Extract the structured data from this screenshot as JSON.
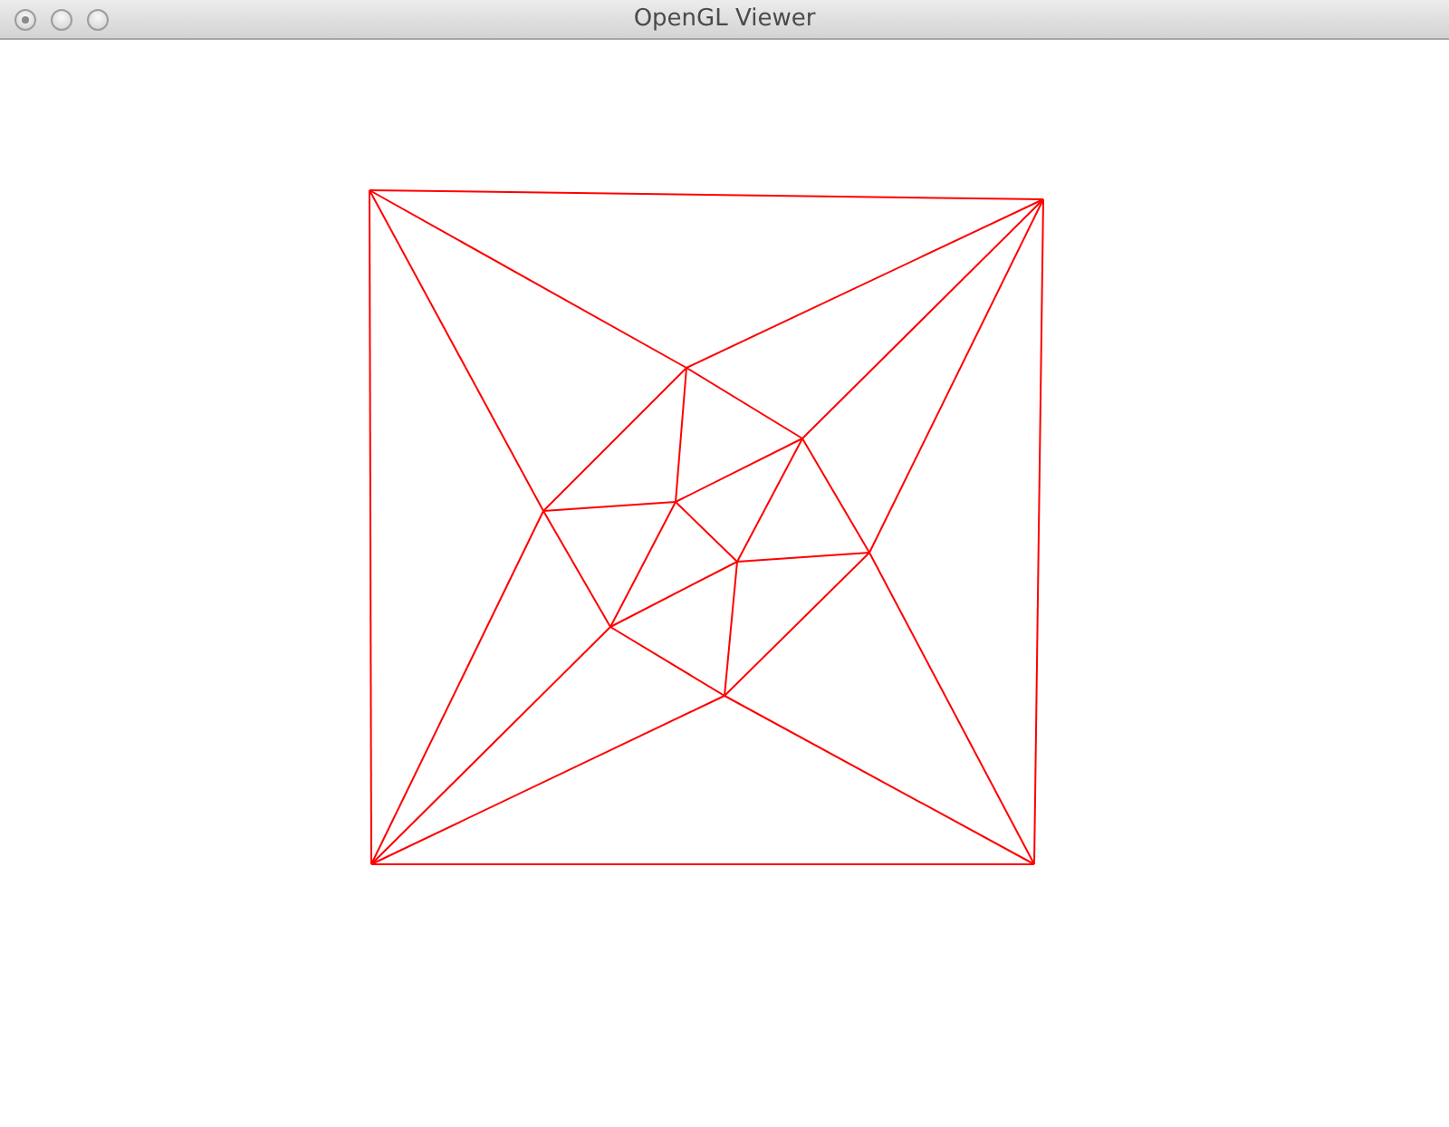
{
  "window": {
    "title": "OpenGL Viewer"
  },
  "viewport": {
    "kind": "wireframe"
  }
}
